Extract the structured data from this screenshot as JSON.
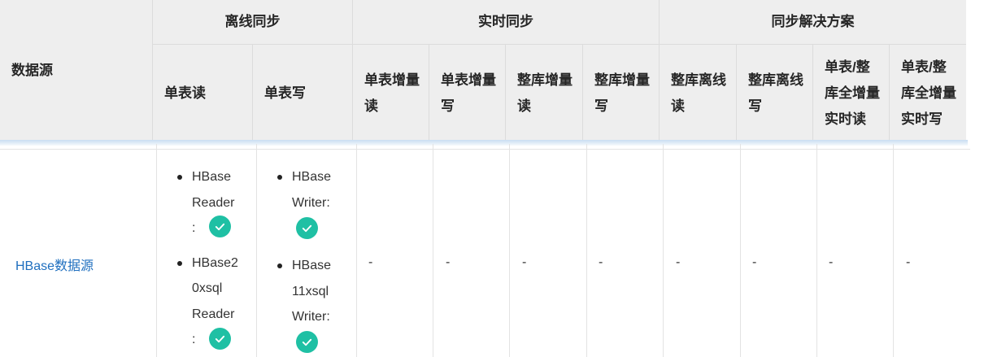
{
  "header": {
    "source": "数据源",
    "groups": {
      "offline": "离线同步",
      "realtime": "实时同步",
      "solution": "同步解决方案"
    },
    "columns": [
      [
        "单表读"
      ],
      [
        "单表写"
      ],
      [
        "单表增量",
        "读"
      ],
      [
        "单表增量",
        "写"
      ],
      [
        "整库增量",
        "读"
      ],
      [
        "整库增量",
        "写"
      ],
      [
        "整库离线",
        "读"
      ],
      [
        "整库离线",
        "写"
      ],
      [
        "单表/整",
        "库全增量",
        "实时读"
      ],
      [
        "单表/整",
        "库全增量",
        "实时写"
      ]
    ]
  },
  "row": {
    "source": "HBase数据源",
    "read_items": [
      {
        "lines": [
          "HBase",
          "Reader",
          ":"
        ],
        "status": "check-icon"
      },
      {
        "lines": [
          "HBase2",
          "0xsql",
          "Reader",
          ":"
        ],
        "status": "check-icon"
      }
    ],
    "write_items": [
      {
        "lines": [
          "HBase",
          "Writer:"
        ],
        "status": "check-icon"
      },
      {
        "lines": [
          "HBase",
          "11xsql",
          "Writer:"
        ],
        "status": "check-icon"
      }
    ],
    "dashes": [
      "-",
      "-",
      "-",
      "-",
      "-",
      "-",
      "-",
      "-"
    ]
  },
  "colors": {
    "link": "#1f6fbf",
    "check": "#1fc0a4",
    "header_bg": "#eeeeee"
  }
}
